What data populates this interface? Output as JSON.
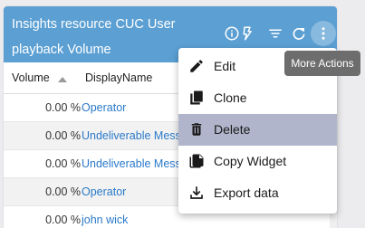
{
  "widget": {
    "title": "Insights resource CUC User playback Volume",
    "header_color": "#5b9fd3",
    "icons": [
      "info-icon",
      "bolt-icon",
      "filter-icon",
      "refresh-icon",
      "more-vert-icon"
    ]
  },
  "table": {
    "columns": [
      "Volume",
      "DisplayName"
    ],
    "sort": "ascending",
    "rows": [
      {
        "volume": "0.00 %",
        "name": "Operator"
      },
      {
        "volume": "0.00 %",
        "name": "Undeliverable Messa"
      },
      {
        "volume": "0.00 %",
        "name": "Undeliverable Messa"
      },
      {
        "volume": "0.00 %",
        "name": "Operator"
      },
      {
        "volume": "0.00 %",
        "name": "john wick"
      }
    ],
    "link_color": "#2a79c9"
  },
  "menu": {
    "items": [
      {
        "label": "Edit",
        "icon": "pencil-icon"
      },
      {
        "label": "Clone",
        "icon": "clone-icon"
      },
      {
        "label": "Delete",
        "icon": "trash-icon"
      },
      {
        "label": "Copy Widget",
        "icon": "copy-icon"
      },
      {
        "label": "Export data",
        "icon": "download-icon"
      }
    ],
    "highlighted": "Delete"
  },
  "tooltip": "More Actions"
}
